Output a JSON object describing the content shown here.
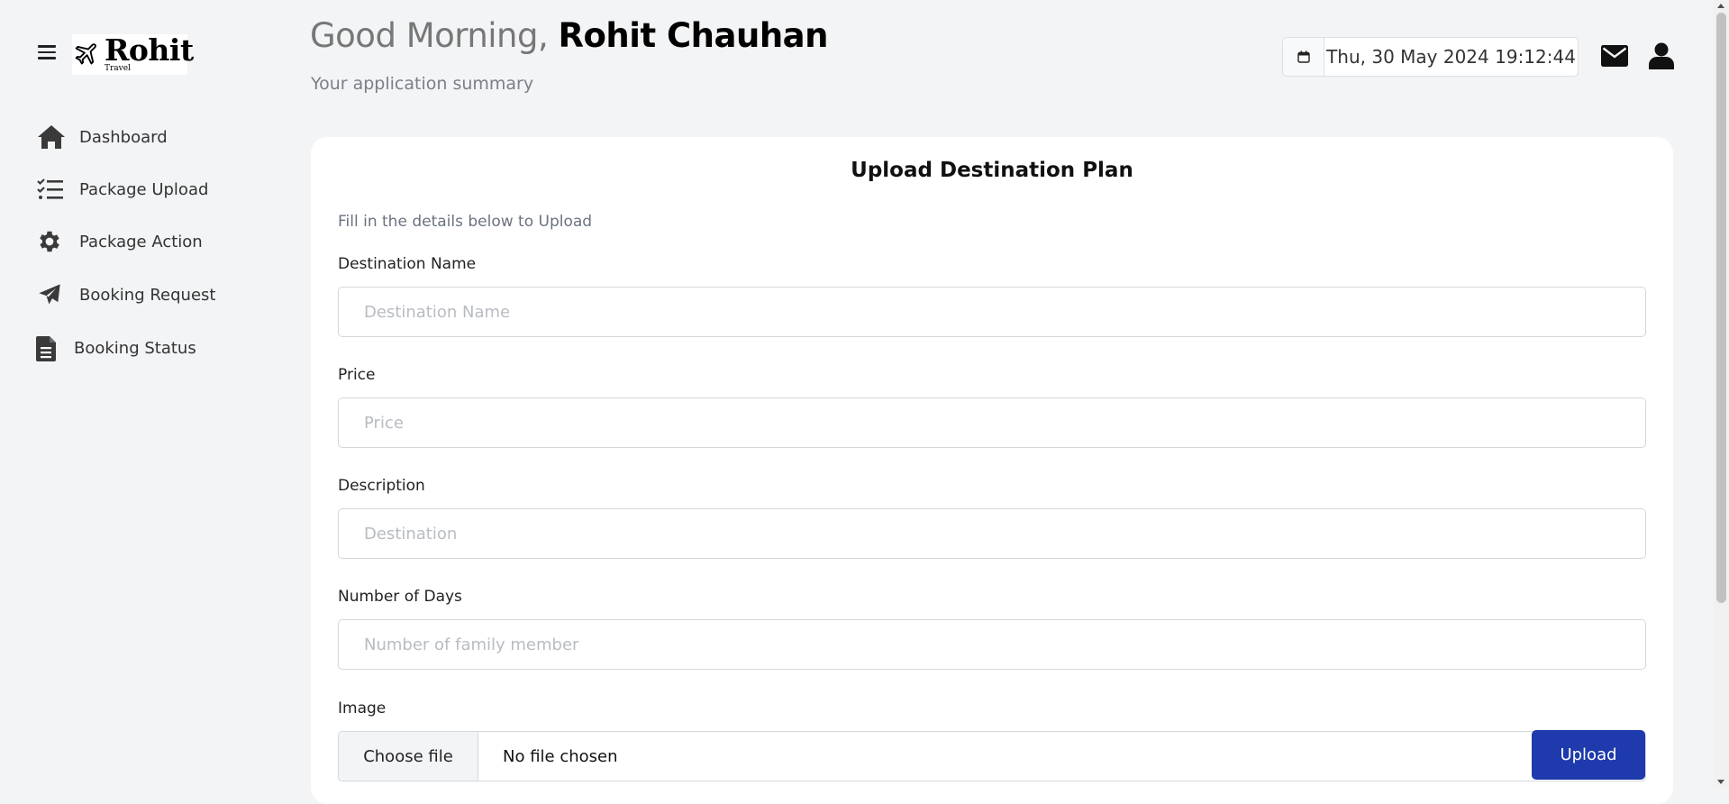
{
  "brand": {
    "name": "Rohit",
    "tagline": "Travel"
  },
  "header": {
    "greeting": "Good Morning,",
    "user_name": "Rohit Chauhan",
    "subtitle": "Your application summary",
    "datetime": "Thu, 30 May 2024 19:12:44"
  },
  "sidebar": {
    "items": [
      {
        "label": "Dashboard",
        "icon": "home-icon"
      },
      {
        "label": "Package Upload",
        "icon": "list-check-icon"
      },
      {
        "label": "Package Action",
        "icon": "gear-icon"
      },
      {
        "label": "Booking Request",
        "icon": "paper-plane-icon"
      },
      {
        "label": "Booking Status",
        "icon": "file-text-icon"
      }
    ]
  },
  "form": {
    "title": "Upload Destination Plan",
    "description": "Fill in the details below to Upload",
    "fields": [
      {
        "label": "Destination Name",
        "placeholder": "Destination Name",
        "value": ""
      },
      {
        "label": "Price",
        "placeholder": "Price",
        "value": ""
      },
      {
        "label": "Description",
        "placeholder": "Destination",
        "value": ""
      },
      {
        "label": "Number of Days",
        "placeholder": "Number of family member",
        "value": ""
      }
    ],
    "image": {
      "label": "Image",
      "choose_label": "Choose file",
      "file_status": "No file chosen"
    },
    "submit_label": "Upload"
  },
  "colors": {
    "background": "#f3f4f6",
    "card": "#ffffff",
    "accent": "#1e3aad"
  }
}
